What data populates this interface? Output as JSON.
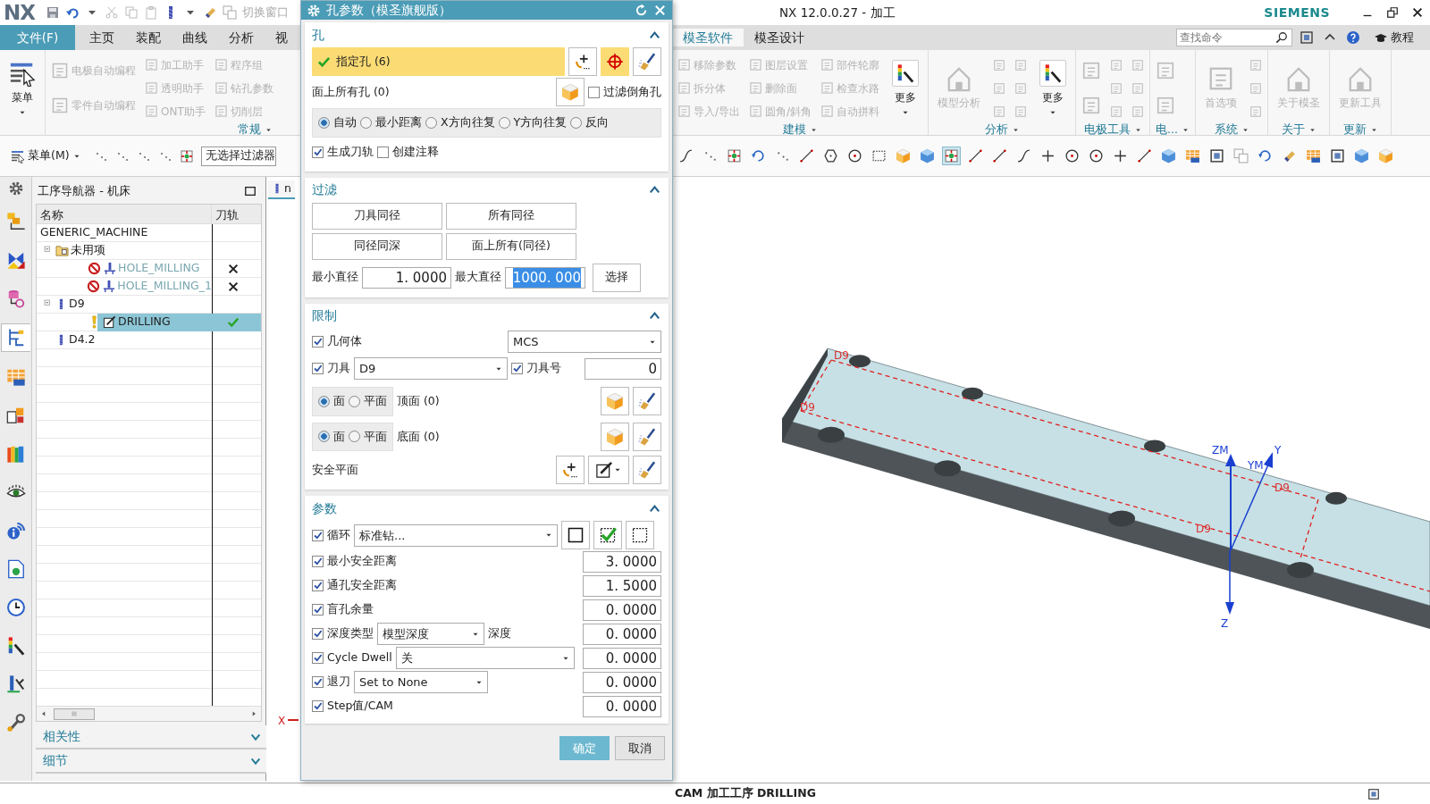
{
  "title_bar": {
    "logo": "NX",
    "switch_window": "切换窗口",
    "title": "NX 12.0.0.27 - 加工",
    "brand": "SIEMENS"
  },
  "menu_tabs": [
    {
      "label": "文件(F)",
      "kind": "file",
      "selected": false
    },
    {
      "label": "主页",
      "kind": "tab",
      "selected": false
    },
    {
      "label": "装配",
      "kind": "tab",
      "selected": false
    },
    {
      "label": "曲线",
      "kind": "tab",
      "selected": false
    },
    {
      "label": "分析",
      "kind": "tab",
      "selected": false
    },
    {
      "label": "视",
      "kind": "tab",
      "selected": false
    }
  ],
  "menu_tabs_right": [
    {
      "label": "模圣软件",
      "kind": "tab",
      "selected": true
    },
    {
      "label": "模圣设计",
      "kind": "tab",
      "selected": false
    }
  ],
  "search": {
    "placeholder": "查找命令"
  },
  "tutorial": "教程",
  "ribbon_left": [
    {
      "items": [
        {
          "kind": "large",
          "label": "菜单",
          "disabled": false
        }
      ]
    },
    {
      "label": "常规",
      "items": [
        {
          "kind": "medium",
          "label": "电极自动编程",
          "disabled": true
        },
        {
          "kind": "medium",
          "label": "零件自动编程",
          "disabled": true
        },
        {
          "kind": "small",
          "label": "加工助手",
          "disabled": true
        },
        {
          "kind": "small",
          "label": "透明助手",
          "disabled": true
        },
        {
          "kind": "small",
          "label": "ONT助手",
          "disabled": true
        },
        {
          "kind": "small",
          "label": "程序组",
          "disabled": true
        },
        {
          "kind": "small",
          "label": "钻孔参数",
          "disabled": true
        },
        {
          "kind": "small",
          "label": "切削层",
          "disabled": true
        }
      ]
    }
  ],
  "ribbon_right": [
    {
      "label": "建模",
      "items": [
        {
          "kind": "small",
          "label": "移除参数",
          "disabled": true
        },
        {
          "kind": "small",
          "label": "拆分体",
          "disabled": true
        },
        {
          "kind": "small",
          "label": "导入/导出",
          "disabled": true
        },
        {
          "kind": "small",
          "label": "图层设置",
          "disabled": true
        },
        {
          "kind": "small",
          "label": "删除面",
          "disabled": true
        },
        {
          "kind": "small",
          "label": "圆角/斜角",
          "disabled": true
        },
        {
          "kind": "small",
          "label": "部件轮廓",
          "disabled": true
        },
        {
          "kind": "small",
          "label": "检查水路",
          "disabled": true
        },
        {
          "kind": "small",
          "label": "自动拼料",
          "disabled": true
        },
        {
          "kind": "large",
          "label": "更多",
          "disabled": false
        }
      ]
    },
    {
      "label": "分析",
      "items": [
        {
          "kind": "large",
          "label": "模型分析",
          "disabled": true
        },
        {
          "kind": "icon",
          "disabled": true
        },
        {
          "kind": "icon",
          "disabled": true
        },
        {
          "kind": "icon",
          "disabled": true
        },
        {
          "kind": "icon",
          "disabled": true
        },
        {
          "kind": "icon",
          "disabled": true
        },
        {
          "kind": "icon",
          "disabled": true
        },
        {
          "kind": "large",
          "label": "更多",
          "disabled": false
        }
      ]
    },
    {
      "label": "电极工具",
      "items": [
        {
          "kind": "medium_icon",
          "disabled": true
        },
        {
          "kind": "medium_icon",
          "disabled": true
        },
        {
          "kind": "icon",
          "disabled": true
        },
        {
          "kind": "icon",
          "disabled": true
        },
        {
          "kind": "icon",
          "disabled": true
        },
        {
          "kind": "icon",
          "disabled": true
        },
        {
          "kind": "icon",
          "disabled": true
        },
        {
          "kind": "icon",
          "disabled": true
        }
      ]
    },
    {
      "label": "电...",
      "items": [
        {
          "kind": "medium_icon",
          "disabled": true
        },
        {
          "kind": "medium_icon",
          "disabled": true
        }
      ]
    },
    {
      "label": "系统",
      "items": [
        {
          "kind": "large",
          "label": "首选项",
          "disabled": true
        },
        {
          "kind": "icon",
          "disabled": true
        },
        {
          "kind": "icon",
          "disabled": true
        },
        {
          "kind": "icon",
          "disabled": true
        }
      ]
    },
    {
      "label": "关于",
      "items": [
        {
          "kind": "large",
          "label": "关于模圣",
          "disabled": true
        }
      ]
    },
    {
      "label": "更新",
      "items": [
        {
          "kind": "large",
          "label": "更新工具",
          "disabled": true
        }
      ]
    }
  ],
  "toolbar": {
    "menu_button": "菜单(M)",
    "filter": "无选择过滤器"
  },
  "resource_bar": [
    {
      "selected": false
    },
    {
      "selected": false
    },
    {
      "selected": false
    },
    {
      "selected": true
    },
    {
      "selected": false
    },
    {
      "selected": false
    },
    {
      "selected": false
    },
    {
      "selected": false
    },
    {
      "selected": false
    },
    {
      "selected": false
    },
    {
      "selected": false
    },
    {
      "selected": false
    },
    {
      "selected": false
    },
    {
      "selected": false
    }
  ],
  "navigator": {
    "title": "工序导航器 - 机床",
    "columns": [
      "名称",
      "刀轨"
    ],
    "rows": [
      {
        "name": "GENERIC_MACHINE",
        "kind": "machine",
        "selected": false,
        "children": [
          {
            "name": "未用项",
            "kind": "group",
            "expanded": true,
            "selected": false,
            "children": [
              {
                "name": "HOLE_MILLING",
                "kind": "operation",
                "excluded": true,
                "warning": false,
                "disabled": true,
                "toolpath_ok": false,
                "selected": false
              },
              {
                "name": "HOLE_MILLING_1",
                "kind": "operation",
                "excluded": true,
                "warning": false,
                "disabled": true,
                "toolpath_ok": false,
                "selected": false
              }
            ]
          },
          {
            "name": "D9",
            "kind": "tool",
            "expanded": true,
            "selected": false,
            "children": [
              {
                "name": "DRILLING",
                "kind": "operation",
                "excluded": false,
                "warning": true,
                "disabled": false,
                "toolpath_ok": true,
                "selected": true
              }
            ]
          },
          {
            "name": "D4.2",
            "kind": "tool",
            "selected": false
          }
        ]
      }
    ],
    "panels": [
      {
        "label": "相关性",
        "expanded": false
      },
      {
        "label": "细节",
        "expanded": false
      }
    ]
  },
  "viewport": {
    "tab": "n",
    "hole_labels": [
      "D9",
      "D9",
      "D9",
      "D9"
    ],
    "axis_labels": [
      "ZM",
      "YM",
      "Y",
      "Z"
    ],
    "wcs_label": "X"
  },
  "dialog": {
    "title": "孔参数（模圣旗舰版）",
    "sections": [
      {
        "kind": "holes",
        "title": "孔",
        "expanded": true,
        "specify": {
          "label": "指定孔 (6)",
          "done": true,
          "active": true
        },
        "face_holes": "面上所有孔 (0)",
        "filter_chamfer": {
          "label": "过滤倒角孔",
          "checked": false
        },
        "order": [
          {
            "label": "自动",
            "selected": true
          },
          {
            "label": "最小距离",
            "selected": false
          },
          {
            "label": "X方向往复",
            "selected": false
          },
          {
            "label": "Y方向往复",
            "selected": false
          },
          {
            "label": "反向",
            "selected": false
          }
        ],
        "options": [
          {
            "label": "生成刀轨",
            "checked": true
          },
          {
            "label": "创建注释",
            "checked": false
          }
        ]
      },
      {
        "kind": "filter",
        "title": "过滤",
        "expanded": true,
        "buttons": [
          "刀具同径",
          "所有同径",
          "同径同深",
          "面上所有(同径)"
        ],
        "min_label": "最小直径",
        "min_value": "1. 0000",
        "max_label": "最大直径",
        "max_value": "1000. 000",
        "max_selected": true,
        "select_button": "选择"
      },
      {
        "kind": "limits",
        "title": "限制",
        "expanded": true,
        "geometry": {
          "label": "几何体",
          "checked": true,
          "value": "MCS"
        },
        "tool": {
          "label": "刀具",
          "checked": true,
          "value": "D9"
        },
        "tool_number": {
          "label": "刀具号",
          "checked": true,
          "value": "0"
        },
        "surfaces": [
          {
            "modes": [
              {
                "label": "面",
                "selected": true
              },
              {
                "label": "平面",
                "selected": false
              }
            ],
            "label": "顶面 (0)"
          },
          {
            "modes": [
              {
                "label": "面",
                "selected": true
              },
              {
                "label": "平面",
                "selected": false
              }
            ],
            "label": "底面 (0)"
          }
        ],
        "safe_plane": "安全平面"
      },
      {
        "kind": "params",
        "title": "参数",
        "expanded": true,
        "cycle": {
          "label": "循环",
          "checked": true,
          "value": "标准钻..."
        },
        "rows": [
          {
            "label": "最小安全距离",
            "checked": true,
            "value": "3. 0000"
          },
          {
            "label": "通孔安全距离",
            "checked": true,
            "value": "1. 5000"
          },
          {
            "label": "盲孔余量",
            "checked": true,
            "value": "0. 0000"
          },
          {
            "label": "深度类型",
            "checked": true,
            "select": "模型深度",
            "extra": "深度",
            "value": "0. 0000"
          },
          {
            "label": "Cycle Dwell",
            "checked": true,
            "select": "关",
            "value": "0. 0000"
          },
          {
            "label": "退刀",
            "checked": true,
            "select": "Set to None",
            "value": "0. 0000"
          },
          {
            "label": "Step值/CAM",
            "checked": true,
            "value": "0. 0000"
          }
        ]
      }
    ],
    "buttons": [
      {
        "label": "确定",
        "kind": "primary"
      },
      {
        "label": "取消",
        "kind": "secondary"
      }
    ]
  },
  "status_bar": {
    "text": "CAM 加工工序 DRILLING"
  }
}
